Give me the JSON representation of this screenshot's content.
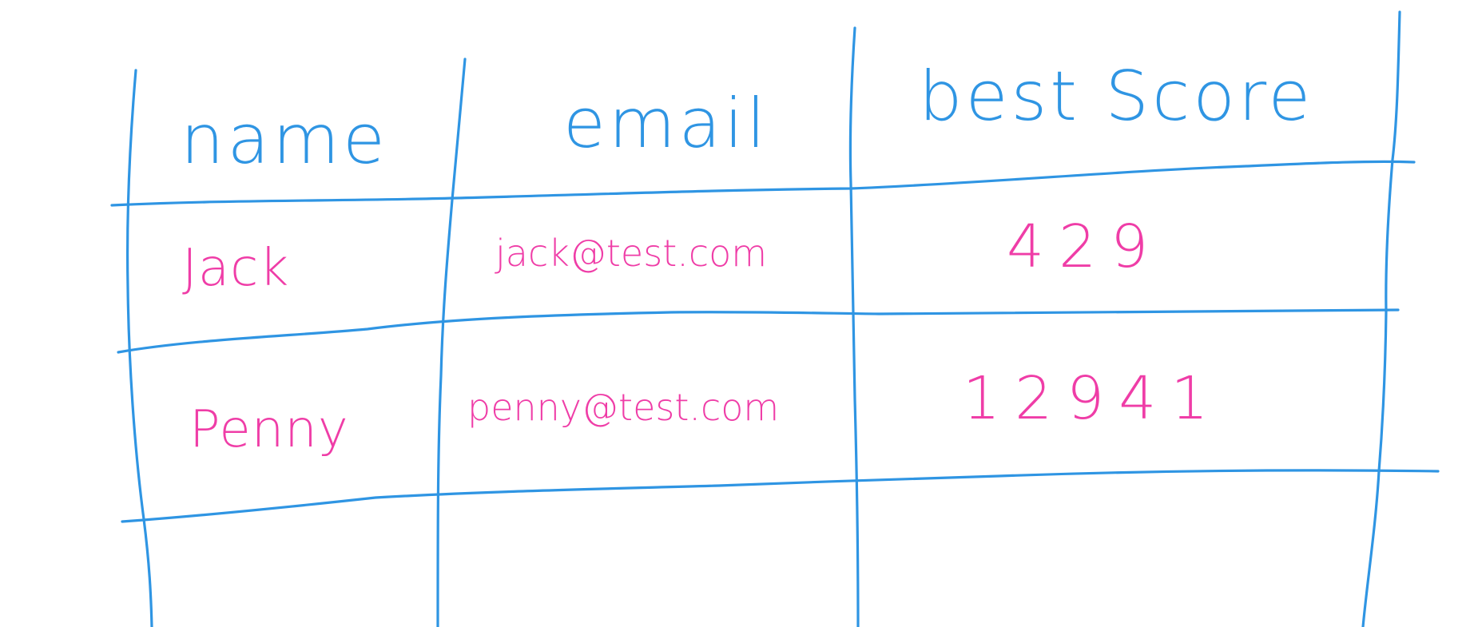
{
  "table": {
    "headers": {
      "name": "name",
      "email": "email",
      "best_score": "best Score"
    },
    "rows": [
      {
        "name": "Jack",
        "email": "jack@test.com",
        "best_score": "429"
      },
      {
        "name": "Penny",
        "email": "penny@test.com",
        "best_score": "12941"
      }
    ]
  },
  "colors": {
    "grid": "#2f95e3",
    "header_text": "#2f95e3",
    "body_text": "#ef3da7",
    "background": "#ffffff"
  }
}
